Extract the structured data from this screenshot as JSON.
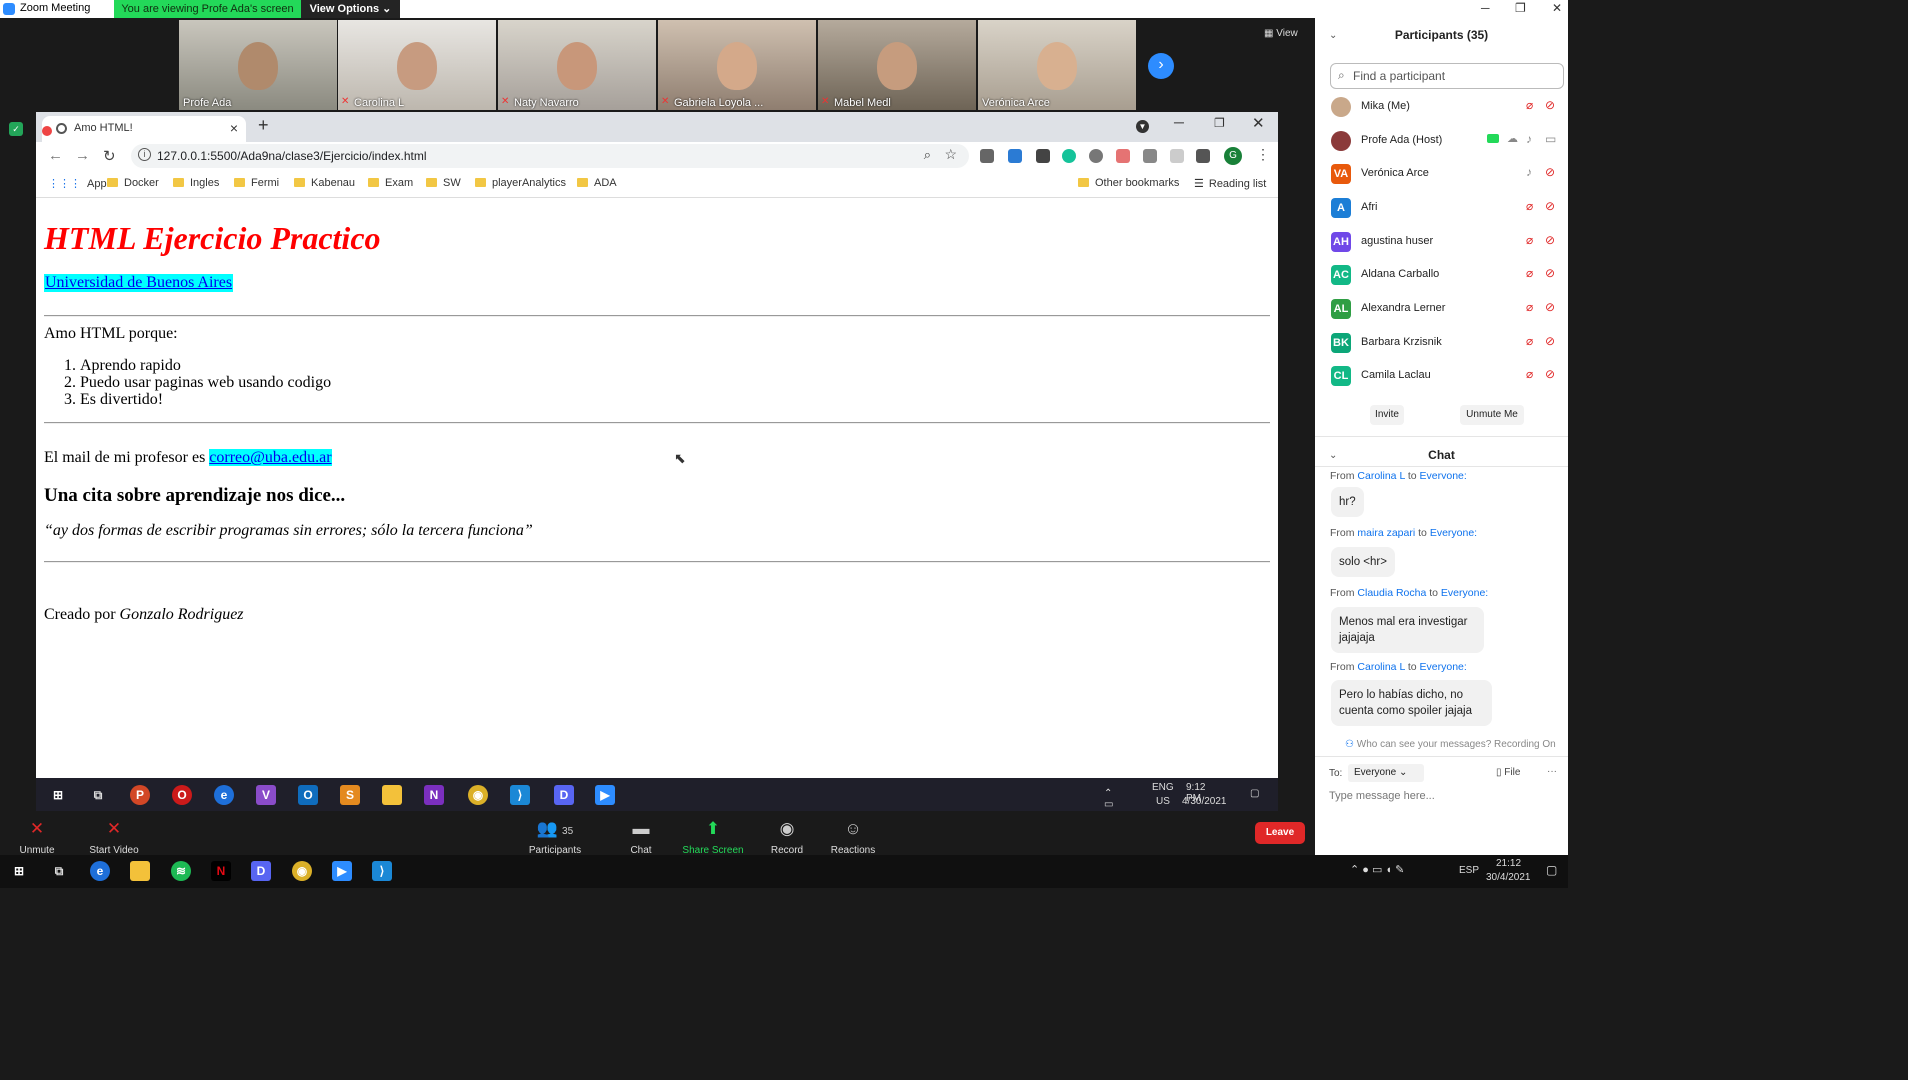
{
  "zoom": {
    "window_title": "Zoom Meeting",
    "viewing_banner": "You are viewing Profe Ada's screen",
    "view_options": "View Options",
    "view_label": "View",
    "thumbnails": [
      {
        "name": "Profe Ada",
        "muted": false
      },
      {
        "name": "Carolina L",
        "muted": true
      },
      {
        "name": "Naty Navarro",
        "muted": true
      },
      {
        "name": "Gabriela Loyola ...",
        "muted": true
      },
      {
        "name": "Mabel Medl",
        "muted": true
      },
      {
        "name": "Verónica Arce",
        "muted": false
      }
    ],
    "toolbar": {
      "unmute": "Unmute",
      "start_video": "Start Video",
      "participants": "Participants",
      "participants_count": "35",
      "chat": "Chat",
      "share_screen": "Share Screen",
      "record": "Record",
      "reactions": "Reactions",
      "leave": "Leave"
    }
  },
  "browser": {
    "tab_title": "Amo HTML!",
    "url": "127.0.0.1:5500/Ada9na/clase3/Ejercicio/index.html",
    "profile_letter": "G",
    "bookmarks": [
      "Apps",
      "Docker",
      "Ingles",
      "Fermi",
      "Kabenau",
      "Exam",
      "SW",
      "playerAnalytics",
      "ADA"
    ],
    "other_bookmarks": "Other bookmarks",
    "reading_list": "Reading list"
  },
  "page": {
    "h1": "HTML Ejercicio Practico",
    "link": "Universidad de Buenos Aires",
    "amo": "Amo HTML porque:",
    "list": [
      "Aprendo rapido",
      "Puedo usar paginas web usando codigo",
      "Es divertido!"
    ],
    "mail_prefix": "El mail de mi profesor es ",
    "mail": "correo@uba.edu.ar",
    "h3": "Una cita sobre aprendizaje nos dice...",
    "quote": "“ay dos formas de escribir programas sin errores; sólo la tercera funciona”",
    "credit_prefix": "Creado por ",
    "credit_name": "Gonzalo Rodriguez"
  },
  "inner_taskbar": {
    "lang": "ENG",
    "region": "US",
    "time": "9:12 PM",
    "date": "4/30/2021"
  },
  "outer_taskbar": {
    "lang": "ESP",
    "time": "21:12",
    "date": "30/4/2021"
  },
  "participants": {
    "title": "Participants (35)",
    "search_placeholder": "Find a participant",
    "list": [
      {
        "initials": "",
        "name": "Mika (Me)",
        "color": "#c9a88a"
      },
      {
        "initials": "",
        "name": "Profe Ada (Host)",
        "color": "#8b3a3a"
      },
      {
        "initials": "VA",
        "name": "Verónica Arce",
        "color": "#e8590c"
      },
      {
        "initials": "A",
        "name": "Afri",
        "color": "#1c7ed6"
      },
      {
        "initials": "AH",
        "name": "agustina huser",
        "color": "#7048e8"
      },
      {
        "initials": "AC",
        "name": "Aldana Carballo",
        "color": "#12b886"
      },
      {
        "initials": "AL",
        "name": "Alexandra Lerner",
        "color": "#2f9e44"
      },
      {
        "initials": "BK",
        "name": "Barbara Krzisnik",
        "color": "#0ca678"
      },
      {
        "initials": "CL",
        "name": "Camila Laclau",
        "color": "#12b886"
      }
    ],
    "invite": "Invite",
    "unmute_me": "Unmute Me"
  },
  "chat": {
    "title": "Chat",
    "messages": [
      {
        "from": "Carolina L",
        "to": "Everyone:",
        "text": "hr?"
      },
      {
        "from": "maira zapari",
        "to": "Everyone:",
        "text": "solo <hr>"
      },
      {
        "from": "Claudia Rocha",
        "to": "Everyone:",
        "text": "Menos mal era investigar jajajaja"
      },
      {
        "from": "Carolina L",
        "to": "Everyone:",
        "text": "Pero lo habías dicho, no cuenta como spoiler jajaja"
      }
    ],
    "from_word": "From",
    "to_word": "to",
    "who_can_see": "Who can see your messages? Recording On",
    "to_label": "To:",
    "to_value": "Everyone",
    "file": "File",
    "placeholder": "Type message here..."
  }
}
